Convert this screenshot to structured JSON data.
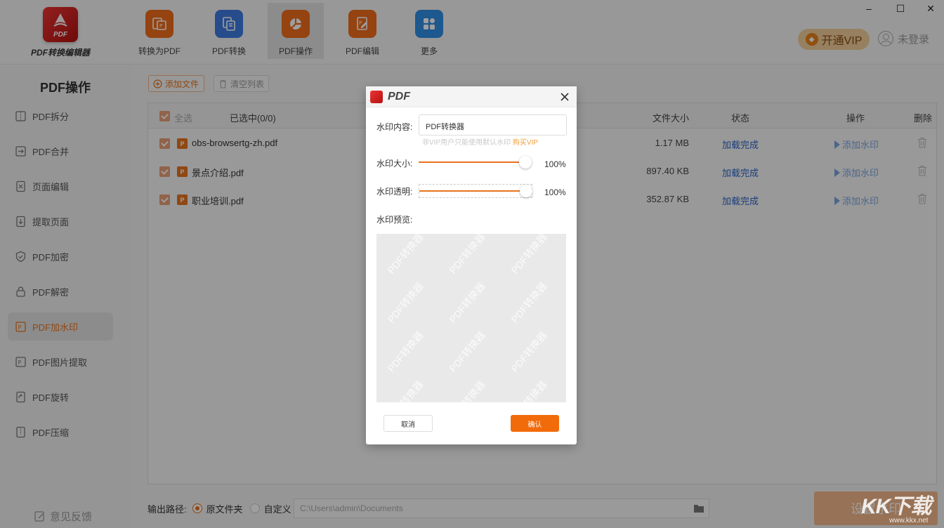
{
  "app": {
    "logo_badge": "PDF",
    "name": "PDF转换编辑器"
  },
  "nav": [
    {
      "label": "转换为PDF",
      "color": "#ef6c1c"
    },
    {
      "label": "PDF转换",
      "color": "#3f7be0"
    },
    {
      "label": "PDF操作",
      "color": "#ef6c1c"
    },
    {
      "label": "PDF编辑",
      "color": "#ef6c1c"
    },
    {
      "label": "更多",
      "color": "#2f8fe6"
    }
  ],
  "window": {
    "minimize": "–",
    "maximize": "☐",
    "close": "✕"
  },
  "header": {
    "vip_label": "开通VIP",
    "login_label": "未登录"
  },
  "sidebar": {
    "title": "PDF操作",
    "items": [
      {
        "label": "PDF拆分",
        "icon": "split-icon"
      },
      {
        "label": "PDF合并",
        "icon": "merge-icon"
      },
      {
        "label": "页面编辑",
        "icon": "page-edit-icon"
      },
      {
        "label": "提取页面",
        "icon": "extract-icon"
      },
      {
        "label": "PDF加密",
        "icon": "shield-icon"
      },
      {
        "label": "PDF解密",
        "icon": "lock-icon"
      },
      {
        "label": "PDF加水印",
        "icon": "watermark-icon"
      },
      {
        "label": "PDF图片提取",
        "icon": "image-extract-icon"
      },
      {
        "label": "PDF旋转",
        "icon": "rotate-icon"
      },
      {
        "label": "PDF压缩",
        "icon": "compress-icon"
      }
    ],
    "active_index": 6,
    "feedback_label": "意见反馈"
  },
  "toolbar": {
    "add_label": "添加文件",
    "clear_label": "清空列表"
  },
  "table": {
    "headers": {
      "select_all": "全选",
      "selected_count": "已选中(0/0)",
      "size": "文件大小",
      "status": "状态",
      "action": "操作",
      "delete": "删除"
    },
    "rows": [
      {
        "name": "obs-browsertg-zh.pdf",
        "size": "1.17 MB",
        "status": "加载完成",
        "action": "添加水印"
      },
      {
        "name": "景点介绍.pdf",
        "size": "897.40 KB",
        "status": "加载完成",
        "action": "添加水印"
      },
      {
        "name": "职业培训.pdf",
        "size": "352.87 KB",
        "status": "加载完成",
        "action": "添加水印"
      }
    ],
    "file_badge": "P"
  },
  "footer": {
    "output_label": "输出路径:",
    "option_original": "原文件夹",
    "option_custom": "自定义",
    "path": "C:\\Users\\admin\\Documents",
    "start_label": "设置水印"
  },
  "dialog": {
    "title": "PDF",
    "content_label": "水印内容:",
    "content_value": "PDF转换器",
    "hint": "非VIP用户只能使用默认水印",
    "hint_link": "购买VIP",
    "size_label": "水印大小:",
    "size_value": "100%",
    "size_fraction": 1.0,
    "opacity_label": "水印透明:",
    "opacity_value": "100%",
    "opacity_fraction": 1.0,
    "preview_label": "水印预览:",
    "preview_text": "PDF转换器",
    "cancel_label": "取消",
    "ok_label": "确认"
  },
  "site_watermark": {
    "big": "KK下载",
    "small": "www.kkx.net"
  }
}
